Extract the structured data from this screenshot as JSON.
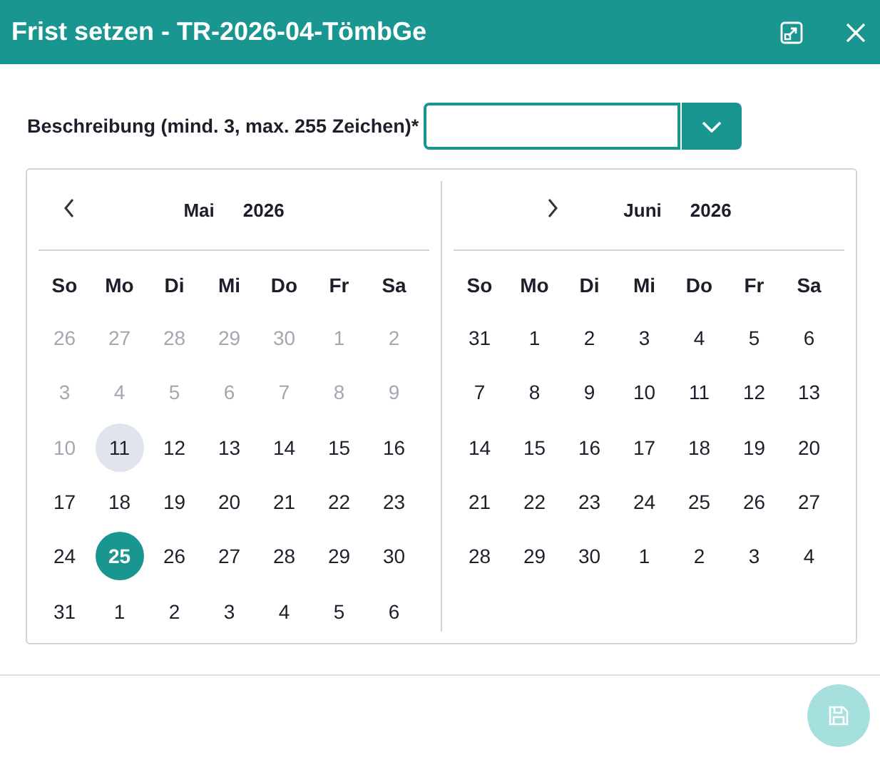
{
  "window": {
    "title": "Frist setzen - TR-2026-04-TömbGe"
  },
  "field": {
    "label": "Beschreibung (mind. 3, max. 255 Zeichen)",
    "required_mark": "*"
  },
  "months": [
    {
      "kind": "prev",
      "month": "Mai",
      "year": "2026",
      "weekdays": [
        "So",
        "Mo",
        "Di",
        "Mi",
        "Do",
        "Fr",
        "Sa"
      ],
      "days": [
        {
          "label": "26",
          "disabled": true,
          "today": false,
          "selected": false
        },
        {
          "label": "27",
          "disabled": true,
          "today": false,
          "selected": false
        },
        {
          "label": "28",
          "disabled": true,
          "today": false,
          "selected": false
        },
        {
          "label": "29",
          "disabled": true,
          "today": false,
          "selected": false
        },
        {
          "label": "30",
          "disabled": true,
          "today": false,
          "selected": false
        },
        {
          "label": "1",
          "disabled": true,
          "today": false,
          "selected": false
        },
        {
          "label": "2",
          "disabled": true,
          "today": false,
          "selected": false
        },
        {
          "label": "3",
          "disabled": true,
          "today": false,
          "selected": false
        },
        {
          "label": "4",
          "disabled": true,
          "today": false,
          "selected": false
        },
        {
          "label": "5",
          "disabled": true,
          "today": false,
          "selected": false
        },
        {
          "label": "6",
          "disabled": true,
          "today": false,
          "selected": false
        },
        {
          "label": "7",
          "disabled": true,
          "today": false,
          "selected": false
        },
        {
          "label": "8",
          "disabled": true,
          "today": false,
          "selected": false
        },
        {
          "label": "9",
          "disabled": true,
          "today": false,
          "selected": false
        },
        {
          "label": "10",
          "disabled": true,
          "today": false,
          "selected": false
        },
        {
          "label": "11",
          "disabled": false,
          "today": true,
          "selected": false
        },
        {
          "label": "12",
          "disabled": false,
          "today": false,
          "selected": false
        },
        {
          "label": "13",
          "disabled": false,
          "today": false,
          "selected": false
        },
        {
          "label": "14",
          "disabled": false,
          "today": false,
          "selected": false
        },
        {
          "label": "15",
          "disabled": false,
          "today": false,
          "selected": false
        },
        {
          "label": "16",
          "disabled": false,
          "today": false,
          "selected": false
        },
        {
          "label": "17",
          "disabled": false,
          "today": false,
          "selected": false
        },
        {
          "label": "18",
          "disabled": false,
          "today": false,
          "selected": false
        },
        {
          "label": "19",
          "disabled": false,
          "today": false,
          "selected": false
        },
        {
          "label": "20",
          "disabled": false,
          "today": false,
          "selected": false
        },
        {
          "label": "21",
          "disabled": false,
          "today": false,
          "selected": false
        },
        {
          "label": "22",
          "disabled": false,
          "today": false,
          "selected": false
        },
        {
          "label": "23",
          "disabled": false,
          "today": false,
          "selected": false
        },
        {
          "label": "24",
          "disabled": false,
          "today": false,
          "selected": false
        },
        {
          "label": "25",
          "disabled": false,
          "today": false,
          "selected": true
        },
        {
          "label": "26",
          "disabled": false,
          "today": false,
          "selected": false
        },
        {
          "label": "27",
          "disabled": false,
          "today": false,
          "selected": false
        },
        {
          "label": "28",
          "disabled": false,
          "today": false,
          "selected": false
        },
        {
          "label": "29",
          "disabled": false,
          "today": false,
          "selected": false
        },
        {
          "label": "30",
          "disabled": false,
          "today": false,
          "selected": false
        },
        {
          "label": "31",
          "disabled": false,
          "today": false,
          "selected": false
        },
        {
          "label": "1",
          "disabled": false,
          "today": false,
          "selected": false
        },
        {
          "label": "2",
          "disabled": false,
          "today": false,
          "selected": false
        },
        {
          "label": "3",
          "disabled": false,
          "today": false,
          "selected": false
        },
        {
          "label": "4",
          "disabled": false,
          "today": false,
          "selected": false
        },
        {
          "label": "5",
          "disabled": false,
          "today": false,
          "selected": false
        },
        {
          "label": "6",
          "disabled": false,
          "today": false,
          "selected": false
        }
      ]
    },
    {
      "kind": "next",
      "month": "Juni",
      "year": "2026",
      "weekdays": [
        "So",
        "Mo",
        "Di",
        "Mi",
        "Do",
        "Fr",
        "Sa"
      ],
      "days": [
        {
          "label": "31",
          "disabled": false,
          "today": false,
          "selected": false
        },
        {
          "label": "1",
          "disabled": false,
          "today": false,
          "selected": false
        },
        {
          "label": "2",
          "disabled": false,
          "today": false,
          "selected": false
        },
        {
          "label": "3",
          "disabled": false,
          "today": false,
          "selected": false
        },
        {
          "label": "4",
          "disabled": false,
          "today": false,
          "selected": false
        },
        {
          "label": "5",
          "disabled": false,
          "today": false,
          "selected": false
        },
        {
          "label": "6",
          "disabled": false,
          "today": false,
          "selected": false
        },
        {
          "label": "7",
          "disabled": false,
          "today": false,
          "selected": false
        },
        {
          "label": "8",
          "disabled": false,
          "today": false,
          "selected": false
        },
        {
          "label": "9",
          "disabled": false,
          "today": false,
          "selected": false
        },
        {
          "label": "10",
          "disabled": false,
          "today": false,
          "selected": false
        },
        {
          "label": "11",
          "disabled": false,
          "today": false,
          "selected": false
        },
        {
          "label": "12",
          "disabled": false,
          "today": false,
          "selected": false
        },
        {
          "label": "13",
          "disabled": false,
          "today": false,
          "selected": false
        },
        {
          "label": "14",
          "disabled": false,
          "today": false,
          "selected": false
        },
        {
          "label": "15",
          "disabled": false,
          "today": false,
          "selected": false
        },
        {
          "label": "16",
          "disabled": false,
          "today": false,
          "selected": false
        },
        {
          "label": "17",
          "disabled": false,
          "today": false,
          "selected": false
        },
        {
          "label": "18",
          "disabled": false,
          "today": false,
          "selected": false
        },
        {
          "label": "19",
          "disabled": false,
          "today": false,
          "selected": false
        },
        {
          "label": "20",
          "disabled": false,
          "today": false,
          "selected": false
        },
        {
          "label": "21",
          "disabled": false,
          "today": false,
          "selected": false
        },
        {
          "label": "22",
          "disabled": false,
          "today": false,
          "selected": false
        },
        {
          "label": "23",
          "disabled": false,
          "today": false,
          "selected": false
        },
        {
          "label": "24",
          "disabled": false,
          "today": false,
          "selected": false
        },
        {
          "label": "25",
          "disabled": false,
          "today": false,
          "selected": false
        },
        {
          "label": "26",
          "disabled": false,
          "today": false,
          "selected": false
        },
        {
          "label": "27",
          "disabled": false,
          "today": false,
          "selected": false
        },
        {
          "label": "28",
          "disabled": false,
          "today": false,
          "selected": false
        },
        {
          "label": "29",
          "disabled": false,
          "today": false,
          "selected": false
        },
        {
          "label": "30",
          "disabled": false,
          "today": false,
          "selected": false
        },
        {
          "label": "1",
          "disabled": false,
          "today": false,
          "selected": false
        },
        {
          "label": "2",
          "disabled": false,
          "today": false,
          "selected": false
        },
        {
          "label": "3",
          "disabled": false,
          "today": false,
          "selected": false
        },
        {
          "label": "4",
          "disabled": false,
          "today": false,
          "selected": false
        }
      ]
    }
  ],
  "save_button": {
    "disabled": true
  }
}
